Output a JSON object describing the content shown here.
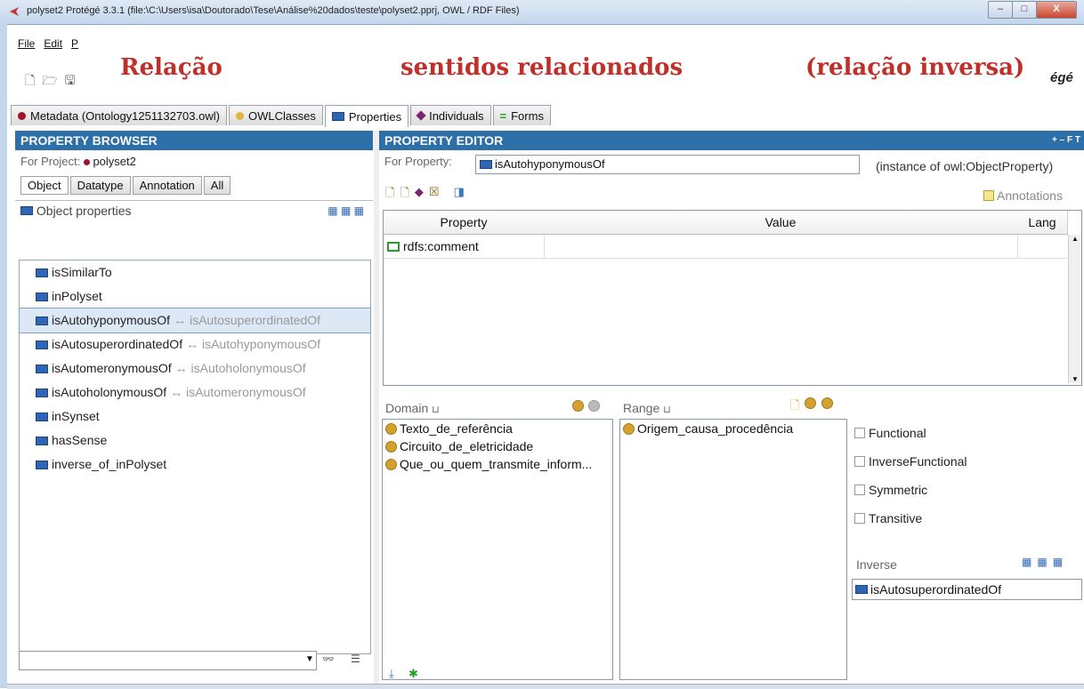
{
  "window": {
    "title": "polyset2  Protégé 3.3.1    (file:\\C:\\Users\\isa\\Doutorado\\Tese\\Análise%20dados\\teste\\polyset2.pprj, OWL / RDF Files)",
    "minimize": "–",
    "maximize": "□",
    "close": "X"
  },
  "menu": {
    "items": [
      "File",
      "Edit",
      "P"
    ]
  },
  "brand": "égé",
  "overlay": {
    "left": "Relação",
    "center": "sentidos relacionados",
    "right": "(relação inversa)"
  },
  "tabs": [
    {
      "label": "Metadata (Ontology1251132703.owl)",
      "icon": "metadata-dot",
      "color": "#a1112c"
    },
    {
      "label": "OWLClasses",
      "icon": "class-dot",
      "color": "#e3b43b"
    },
    {
      "label": "Properties",
      "icon": "property-icon",
      "active": true
    },
    {
      "label": "Individuals",
      "icon": "individual-diamond"
    },
    {
      "label": "Forms",
      "icon": "forms-icon"
    }
  ],
  "browser": {
    "header": "PROPERTY BROWSER",
    "for_project_label": "For Project:",
    "project": "polyset2",
    "subtabs": [
      "Object",
      "Datatype",
      "Annotation",
      "All"
    ],
    "object_properties_label": "Object properties",
    "items": [
      {
        "name": "isSimilarTo",
        "inverse": ""
      },
      {
        "name": "inPolyset",
        "inverse": ""
      },
      {
        "name": "isAutohyponymousOf",
        "inverse": "↔ isAutosuperordinatedOf",
        "selected": true
      },
      {
        "name": "isAutosuperordinatedOf",
        "inverse": "↔ isAutohyponymousOf"
      },
      {
        "name": "isAutomeronymousOf",
        "inverse": "↔ isAutoholonymousOf"
      },
      {
        "name": "isAutoholonymousOf",
        "inverse": "↔ isAutomeronymousOf"
      },
      {
        "name": "inSynset",
        "inverse": ""
      },
      {
        "name": "hasSense",
        "inverse": ""
      },
      {
        "name": "inverse_of_inPolyset",
        "inverse": ""
      }
    ],
    "search_value": ""
  },
  "editor": {
    "header": "PROPERTY EDITOR",
    "header_controls": "+ – F T",
    "for_property_label": "For Property:",
    "property_name": "isAutohyponymousOf",
    "instance_of": "(instance of owl:ObjectProperty)",
    "annotations_label": "Annotations",
    "table": {
      "columns": [
        "Property",
        "Value",
        "Lang"
      ],
      "rows": [
        {
          "property": "rdfs:comment",
          "value": "",
          "lang": ""
        }
      ]
    },
    "domain": {
      "label": "Domain",
      "items": [
        "Texto_de_referência",
        "Circuito_de_eletricidade",
        "Que_ou_quem_transmite_inform..."
      ]
    },
    "range": {
      "label": "Range",
      "items": [
        "Origem_causa_procedência"
      ]
    },
    "characteristics": [
      "Functional",
      "InverseFunctional",
      "Symmetric",
      "Transitive"
    ],
    "inverse": {
      "label": "Inverse",
      "value": "isAutosuperordinatedOf"
    }
  }
}
